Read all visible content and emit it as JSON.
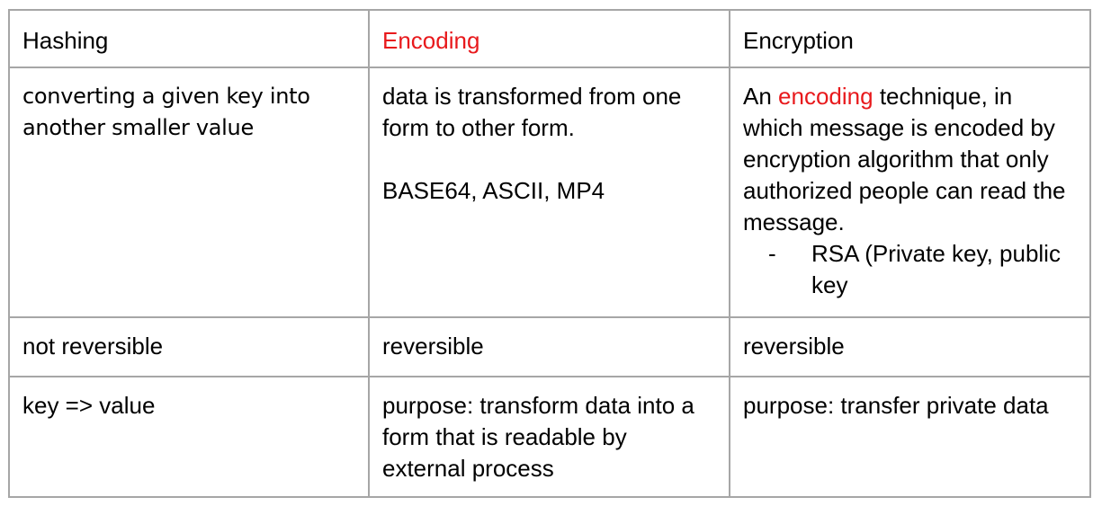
{
  "colors": {
    "highlight": "#e8191c",
    "border": "#a6a6a6",
    "text": "#000000"
  },
  "headers": {
    "hashing": "Hashing",
    "encoding": "Encoding",
    "encryption": "Encryption"
  },
  "row1": {
    "hashing": "converting a given key into another smaller value",
    "encoding_text": "data is transformed from one form to other form.",
    "encoding_examples": "BASE64, ASCII, MP4",
    "encryption_prefix": "An",
    "encryption_highlight": "encoding",
    "encryption_rest": "technique, in which message is encoded by encryption algorithm that only authorized people can read the message.",
    "encryption_bullet_marker": "-",
    "encryption_bullet": "RSA (Private key, public key"
  },
  "row2": {
    "hashing": "not reversible",
    "encoding": "reversible",
    "encryption": "reversible"
  },
  "row3": {
    "hashing": "key => value",
    "encoding": "purpose: transform data into a form that is readable by external process",
    "encryption": "purpose: transfer private data"
  }
}
